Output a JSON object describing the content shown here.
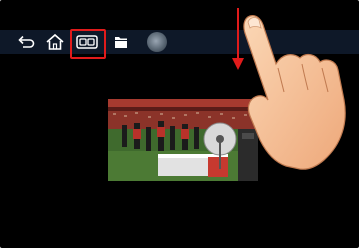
{
  "topbar": {
    "buttons": [
      {
        "name": "back",
        "icon": "back-arrow-icon"
      },
      {
        "name": "home",
        "icon": "home-icon"
      },
      {
        "name": "dual-screen",
        "icon": "dual-screen-icon"
      },
      {
        "name": "file",
        "icon": "folder-icon"
      },
      {
        "name": "assistive",
        "icon": "circle-button-icon"
      }
    ]
  },
  "highlight": {
    "color": "#e11b1b",
    "target": "dual-screen"
  },
  "video": {
    "content": "stadium-sports-scene"
  },
  "gesture": {
    "direction": "down",
    "arrow_color": "#e11b1b",
    "skin_color": "#f6c39a"
  },
  "colors": {
    "background": "#000000",
    "topbar": "#0e1828",
    "icon": "#ffffff"
  }
}
